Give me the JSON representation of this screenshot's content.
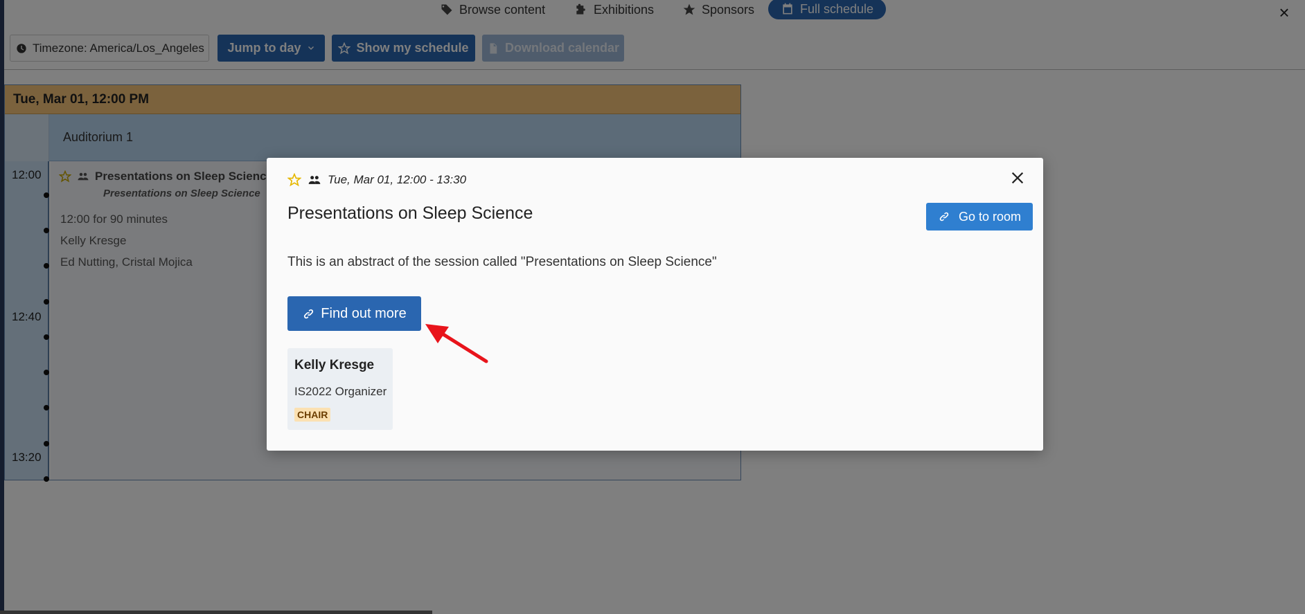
{
  "nav": {
    "items": [
      {
        "label": "Browse content",
        "icon": "tags-icon"
      },
      {
        "label": "Exhibitions",
        "icon": "puzzle-icon"
      },
      {
        "label": "Sponsors",
        "icon": "star-icon"
      },
      {
        "label": "Full schedule",
        "icon": "calendar-icon",
        "active": true
      }
    ]
  },
  "toolbar": {
    "timezone_label": "Timezone: America/Los_Angeles",
    "jump_label": "Jump to day",
    "my_schedule_label": "Show my schedule",
    "download_label": "Download calendar"
  },
  "schedule": {
    "day_header": "Tue, Mar 01, 12:00 PM",
    "room": "Auditorium 1",
    "times": [
      "12:00",
      "12:40",
      "13:20"
    ],
    "session": {
      "title": "Presentations on Sleep Science",
      "subtitle": "Presentations on Sleep Science",
      "duration": "12:00 for 90 minutes",
      "chair": "Kelly Kresge",
      "speakers": "Ed Nutting, Cristal Mojica"
    }
  },
  "modal": {
    "datetime": "Tue, Mar 01, 12:00 - 13:30",
    "title": "Presentations on Sleep Science",
    "go_to_room_label": "Go to room",
    "abstract": "This is an abstract of the session called \"Presentations on Sleep Science\"",
    "find_out_more_label": "Find out more",
    "person": {
      "name": "Kelly Kresge",
      "role": "IS2022 Organizer",
      "badge": "CHAIR"
    }
  },
  "colors": {
    "primary": "#2a66b0",
    "go_room": "#2f7fd0",
    "day_header": "#f7c47b",
    "badge_bg": "#fbe1b2",
    "arrow": "#e8141b"
  }
}
